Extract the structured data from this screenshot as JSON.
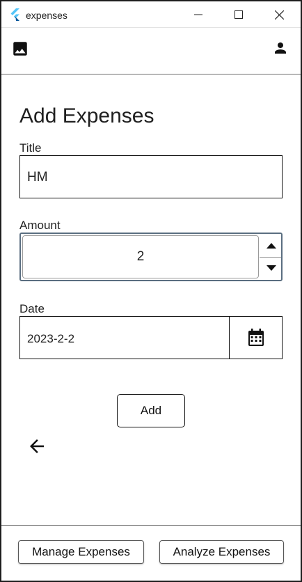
{
  "window": {
    "title": "expenses",
    "controls": {
      "minimize_icon": "minimize-icon",
      "maximize_icon": "maximize-icon",
      "close_icon": "close-icon"
    }
  },
  "appbar": {
    "left_icon": "image-icon",
    "right_icon": "person-icon"
  },
  "form": {
    "heading": "Add Expenses",
    "title": {
      "label": "Title",
      "value": "HM"
    },
    "amount": {
      "label": "Amount",
      "value": "2"
    },
    "date": {
      "label": "Date",
      "value": "2023-2-2",
      "picker_icon": "calendar-icon"
    },
    "submit_label": "Add"
  },
  "back_icon": "arrow-back-icon",
  "bottom_nav": {
    "manage_label": "Manage Expenses",
    "analyze_label": "Analyze Expenses"
  },
  "colors": {
    "focus_border": "#5a6e80",
    "flutter_blue_light": "#54C5F8",
    "flutter_blue_dark": "#01579B"
  }
}
